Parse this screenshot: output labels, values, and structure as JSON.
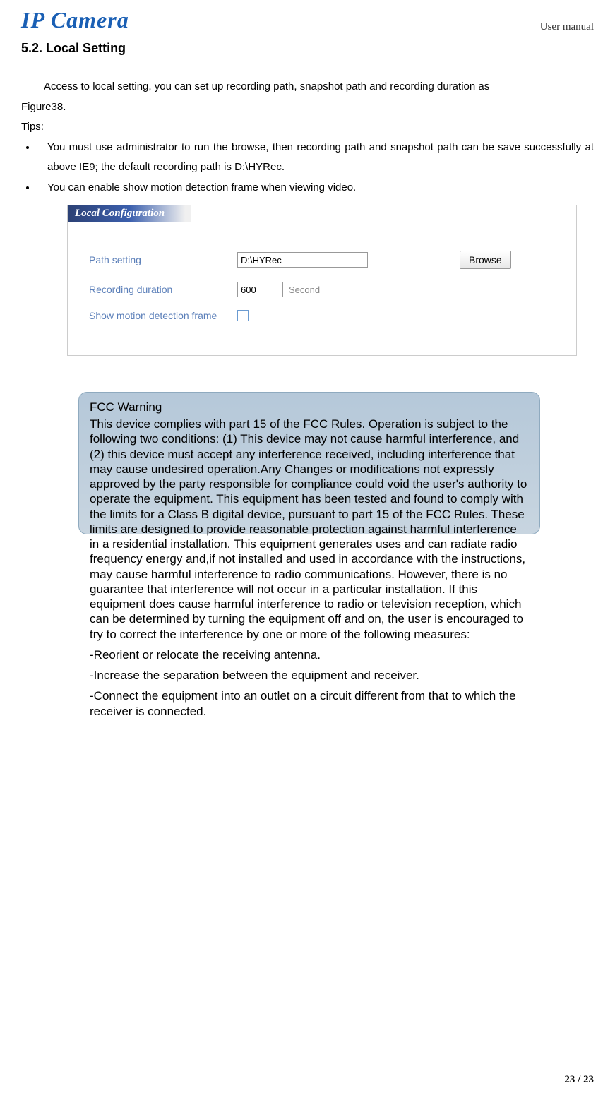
{
  "header": {
    "logo": "IP Camera",
    "right": "User manual"
  },
  "section": {
    "number": "5.2.",
    "title": "Local Setting"
  },
  "intro": {
    "line1": "Access to local setting, you can set up recording path, snapshot path and recording duration as",
    "line2": "Figure38.",
    "tips_label": "Tips:"
  },
  "bullets": [
    "You must use administrator to run the browse, then recording path and snapshot path can be save successfully at above IE9; the default recording path is D:\\HYRec.",
    "You can enable show motion detection frame when viewing video."
  ],
  "config": {
    "title": "Local Configuration",
    "path_label": "Path setting",
    "path_value": "D:\\HYRec",
    "browse_label": "Browse",
    "duration_label": "Recording duration",
    "duration_value": "600",
    "duration_unit": "Second",
    "motion_label": "Show motion detection frame"
  },
  "fcc": {
    "title": "FCC Warning",
    "para1": "This device complies with part 15 of the FCC Rules. Operation is subject to the following two conditions: (1) This device may not cause harmful interference, and (2) this device must accept any interference received, including interference that may cause undesired operation.Any Changes or modifications not expressly approved by the party responsible for compliance could void the user's authority to operate the equipment. This equipment has been tested and found to comply with the limits for a Class B digital device, pursuant to part 15 of the FCC Rules. These limits are designed to provide reasonable protection against harmful interference in a residential installation. This equipment generates uses and can radiate radio frequency energy and,if not installed and used in accordance with the instructions, may cause harmful interference to radio communications. However, there is no guarantee that interference will not occur in a particular installation. If this equipment does cause harmful interference to radio or television reception, which can be determined by turning the equipment off and on, the user is encouraged to try to correct the interference by one or more of the following measures:",
    "item1": "-Reorient or relocate the receiving antenna.",
    "item2": "-Increase the separation between the equipment and receiver.",
    "item3": "-Connect the equipment into an outlet on a circuit different from that to which the receiver is connected."
  },
  "footer": {
    "page": "23 / 23"
  }
}
